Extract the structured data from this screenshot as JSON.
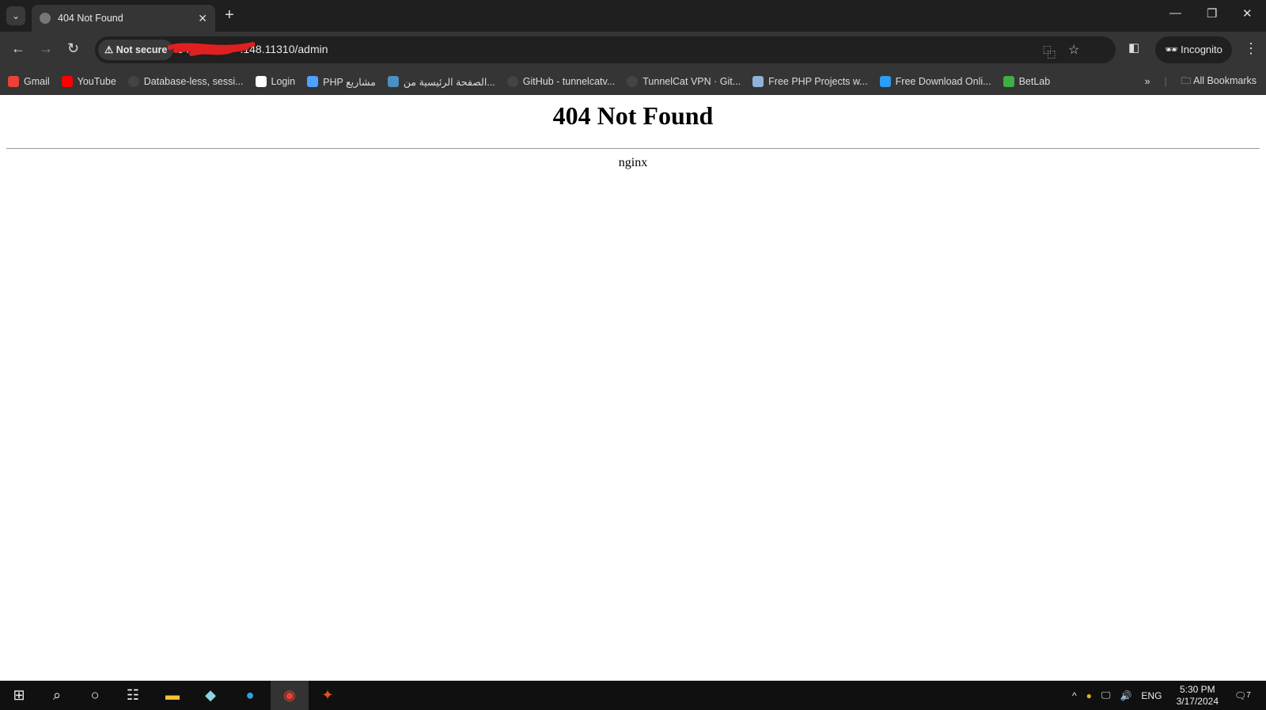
{
  "tab": {
    "title": "404 Not Found"
  },
  "toolbar": {
    "security_label": "Not secure",
    "url_prefix": "54.",
    "url_rest": ".148.11310/admin",
    "incognito_label": "Incognito"
  },
  "bookmarks": [
    {
      "label": "Gmail",
      "color": "#ea4335"
    },
    {
      "label": "YouTube",
      "color": "#ff0000"
    },
    {
      "label": "Database-less, sessi...",
      "color": "#444"
    },
    {
      "label": "Login",
      "color": "#ffffff"
    },
    {
      "label": "PHP مشاريع",
      "color": "#4da3ff"
    },
    {
      "label": "الصفحة الرئيسية من...",
      "color": "#4a90c2"
    },
    {
      "label": "GitHub - tunnelcatv...",
      "color": "#444"
    },
    {
      "label": "TunnelCat VPN · Git...",
      "color": "#444"
    },
    {
      "label": "Free PHP Projects w...",
      "color": "#8fb3d9"
    },
    {
      "label": "Free Download Onli...",
      "color": "#2a9df4"
    },
    {
      "label": "BetLab",
      "color": "#3cb043"
    }
  ],
  "all_bookmarks": "All Bookmarks",
  "page": {
    "heading": "404 Not Found",
    "server": "nginx"
  },
  "taskbar": {
    "lang": "ENG",
    "time": "5:30 PM",
    "date": "3/17/2024",
    "notifications": "7"
  }
}
